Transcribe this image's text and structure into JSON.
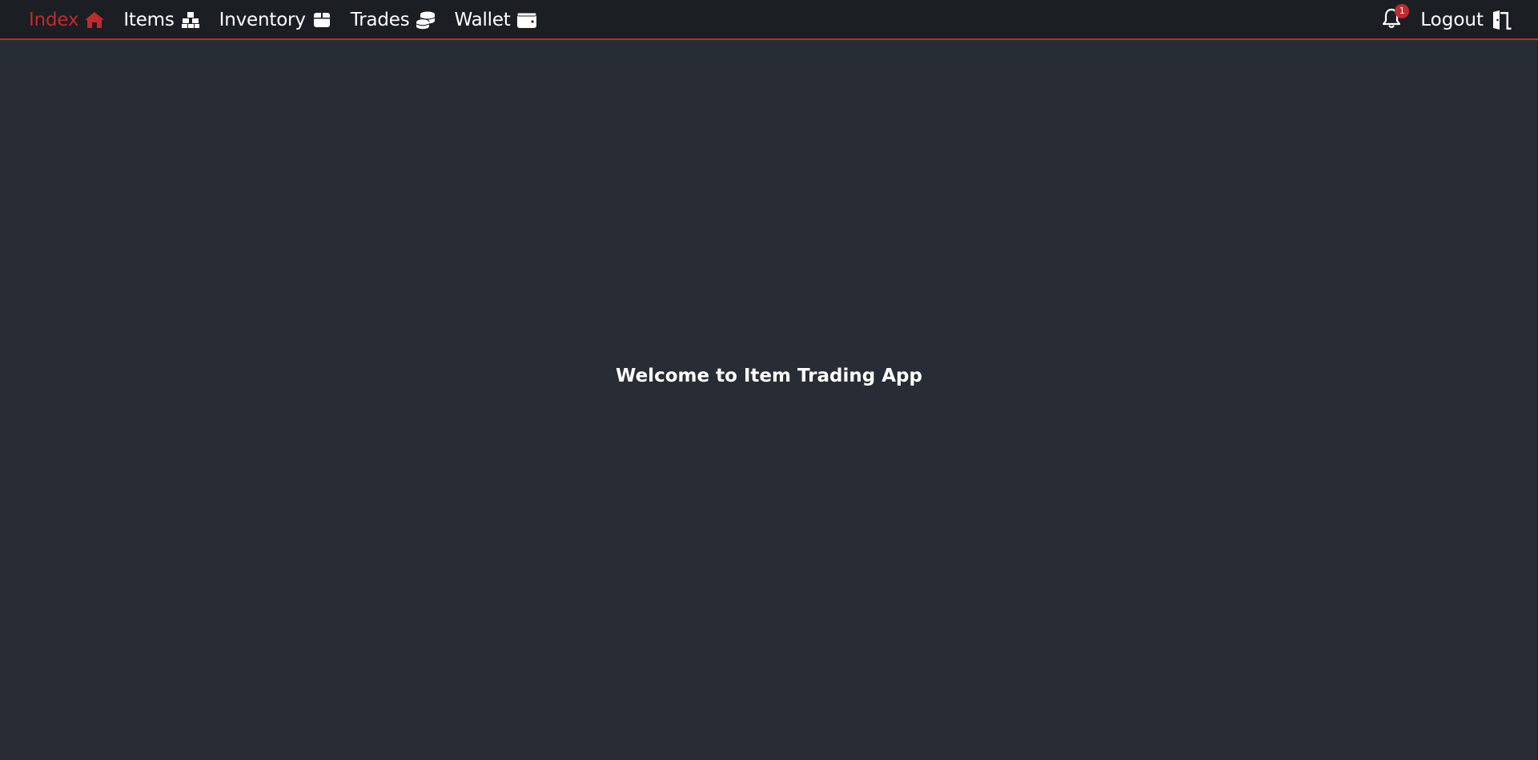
{
  "nav": {
    "items": [
      {
        "label": "Index",
        "icon": "home-icon",
        "active": true
      },
      {
        "label": "Items",
        "icon": "boxes-icon",
        "active": false
      },
      {
        "label": "Inventory",
        "icon": "gift-box-icon",
        "active": false
      },
      {
        "label": "Trades",
        "icon": "coins-icon",
        "active": false
      },
      {
        "label": "Wallet",
        "icon": "wallet-icon",
        "active": false
      }
    ],
    "notifications": {
      "count": "1",
      "icon": "bell-icon"
    },
    "logout": {
      "label": "Logout",
      "icon": "door-open-icon"
    }
  },
  "main": {
    "welcome": "Welcome to Item Trading App"
  },
  "colors": {
    "accent": "#c22a2e",
    "navbar_bg": "#1b1e22",
    "page_bg": "#282d35",
    "text": "#ffffff"
  }
}
